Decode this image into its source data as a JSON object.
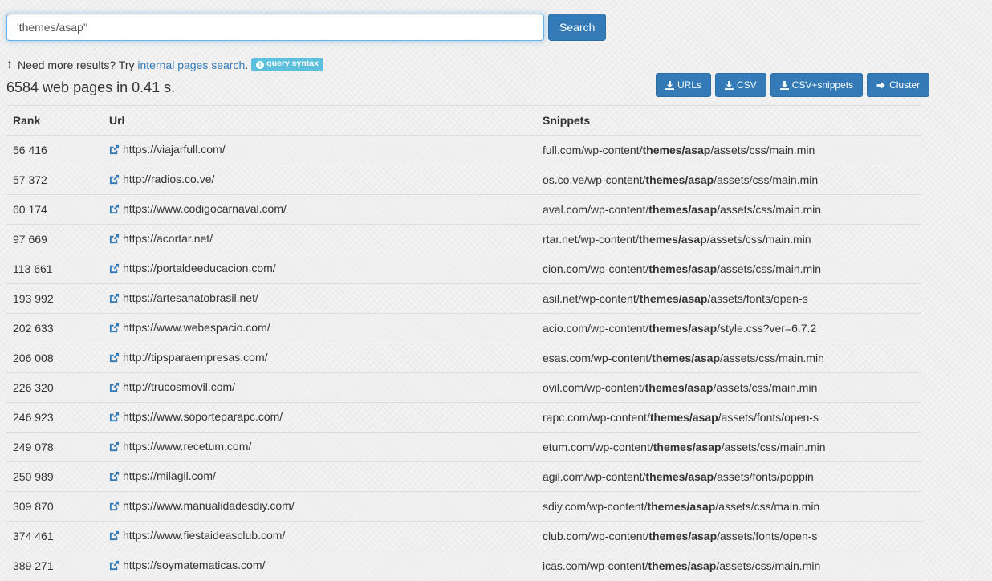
{
  "search": {
    "value": "'themes/asap''",
    "button": "Search"
  },
  "hint": {
    "prefix": "Need more results? Try ",
    "link": "internal pages search",
    "suffix": ".",
    "badge": "query syntax"
  },
  "results_count": "6584 web pages in 0.41 s.",
  "export": {
    "urls": "URLs",
    "csv": "CSV",
    "csv_snippets": "CSV+snippets",
    "cluster": "Cluster"
  },
  "table": {
    "headers": {
      "rank": "Rank",
      "url": "Url",
      "snippets": "Snippets"
    },
    "rows": [
      {
        "rank": "56 416",
        "url": "https://viajarfull.com/",
        "pre": "full.com/wp-content/",
        "bold": "themes/asap",
        "post": "/assets/css/main.min"
      },
      {
        "rank": "57 372",
        "url": "http://radios.co.ve/",
        "pre": "os.co.ve/wp-content/",
        "bold": "themes/asap",
        "post": "/assets/css/main.min"
      },
      {
        "rank": "60 174",
        "url": "https://www.codigocarnaval.com/",
        "pre": "aval.com/wp-content/",
        "bold": "themes/asap",
        "post": "/assets/css/main.min"
      },
      {
        "rank": "97 669",
        "url": "https://acortar.net/",
        "pre": "rtar.net/wp-content/",
        "bold": "themes/asap",
        "post": "/assets/css/main.min"
      },
      {
        "rank": "113 661",
        "url": "https://portaldeeducacion.com/",
        "pre": "cion.com/wp-content/",
        "bold": "themes/asap",
        "post": "/assets/css/main.min"
      },
      {
        "rank": "193 992",
        "url": "https://artesanatobrasil.net/",
        "pre": "asil.net/wp-content/",
        "bold": "themes/asap",
        "post": "/assets/fonts/open-s"
      },
      {
        "rank": "202 633",
        "url": "https://www.webespacio.com/",
        "pre": "acio.com/wp-content/",
        "bold": "themes/asap",
        "post": "/style.css?ver=6.7.2"
      },
      {
        "rank": "206 008",
        "url": "http://tipsparaempresas.com/",
        "pre": "esas.com/wp-content/",
        "bold": "themes/asap",
        "post": "/assets/css/main.min"
      },
      {
        "rank": "226 320",
        "url": "http://trucosmovil.com/",
        "pre": "ovil.com/wp-content/",
        "bold": "themes/asap",
        "post": "/assets/css/main.min"
      },
      {
        "rank": "246 923",
        "url": "https://www.soporteparapc.com/",
        "pre": "rapc.com/wp-content/",
        "bold": "themes/asap",
        "post": "/assets/fonts/open-s"
      },
      {
        "rank": "249 078",
        "url": "https://www.recetum.com/",
        "pre": "etum.com/wp-content/",
        "bold": "themes/asap",
        "post": "/assets/css/main.min"
      },
      {
        "rank": "250 989",
        "url": "https://milagil.com/",
        "pre": "agil.com/wp-content/",
        "bold": "themes/asap",
        "post": "/assets/fonts/poppin"
      },
      {
        "rank": "309 870",
        "url": "https://www.manualidadesdiy.com/",
        "pre": "sdiy.com/wp-content/",
        "bold": "themes/asap",
        "post": "/assets/css/main.min"
      },
      {
        "rank": "374 461",
        "url": "https://www.fiestaideasclub.com/",
        "pre": "club.com/wp-content/",
        "bold": "themes/asap",
        "post": "/assets/fonts/open-s"
      },
      {
        "rank": "389 271",
        "url": "https://soymatematicas.com/",
        "pre": "icas.com/wp-content/",
        "bold": "themes/asap",
        "post": "/assets/css/main.min"
      }
    ]
  }
}
